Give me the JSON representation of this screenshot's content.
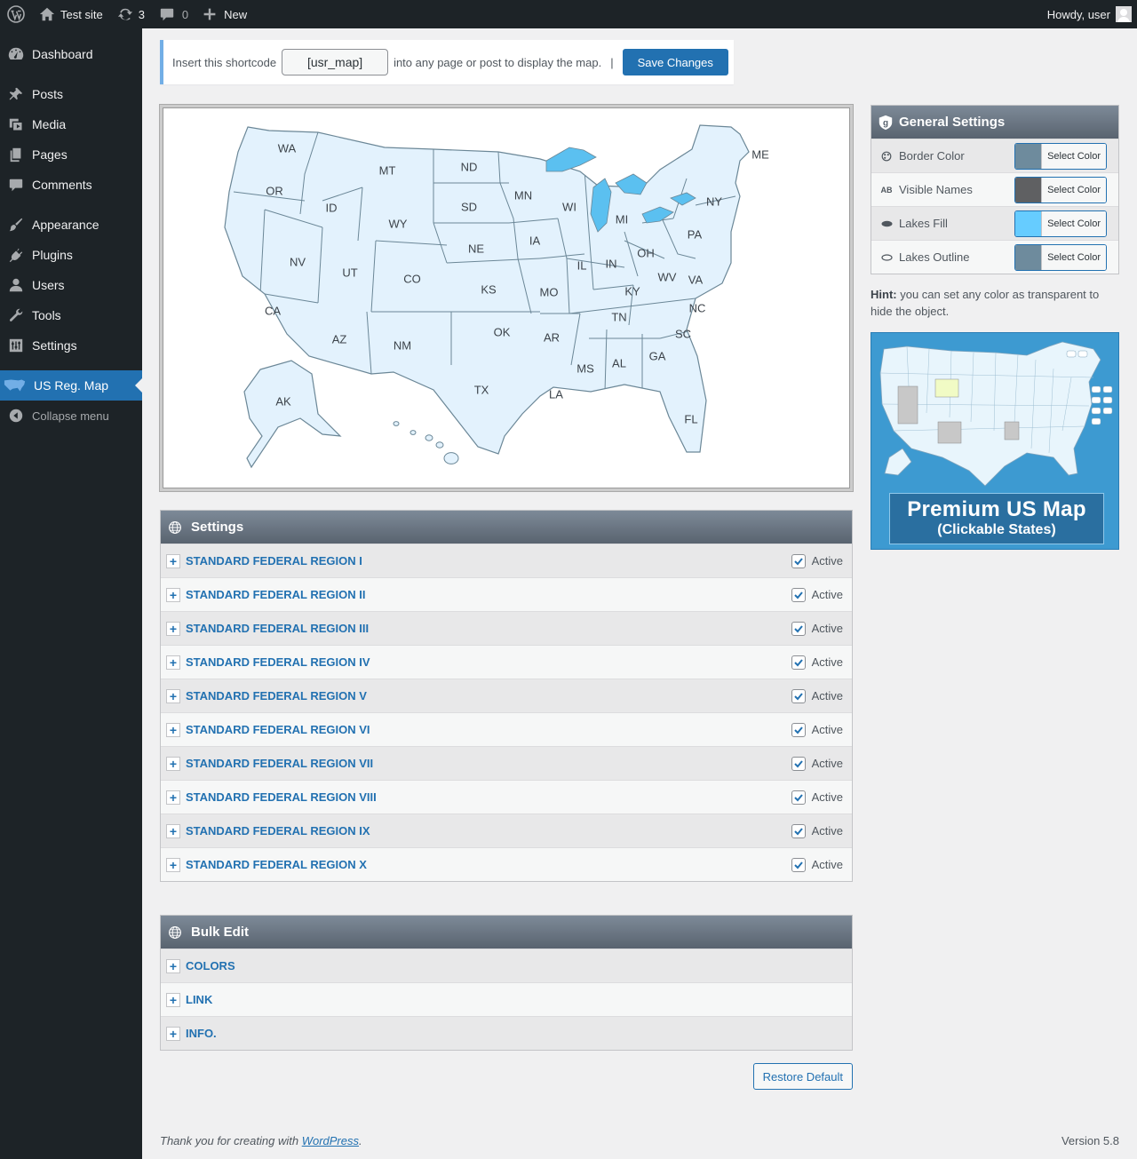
{
  "adminbar": {
    "site_name": "Test site",
    "updates_count": "3",
    "comments_count": "0",
    "new_label": "New",
    "howdy": "Howdy, user"
  },
  "sidebar": {
    "items": [
      {
        "label": "Dashboard"
      },
      {
        "label": "Posts"
      },
      {
        "label": "Media"
      },
      {
        "label": "Pages"
      },
      {
        "label": "Comments"
      },
      {
        "label": "Appearance"
      },
      {
        "label": "Plugins"
      },
      {
        "label": "Users"
      },
      {
        "label": "Tools"
      },
      {
        "label": "Settings"
      },
      {
        "label": "US Reg. Map"
      },
      {
        "label": "Collapse menu"
      }
    ]
  },
  "shortcode": {
    "prefix": "Insert this shortcode",
    "value": "[usr_map]",
    "suffix": "into any page or post to display the map.",
    "separator": "|",
    "save_label": "Save Changes"
  },
  "map": {
    "states": [
      "WA",
      "OR",
      "CA",
      "ID",
      "NV",
      "MT",
      "WY",
      "UT",
      "AZ",
      "CO",
      "NM",
      "ND",
      "SD",
      "NE",
      "KS",
      "OK",
      "TX",
      "MN",
      "IA",
      "MO",
      "AR",
      "LA",
      "WI",
      "IL",
      "MI",
      "IN",
      "OH",
      "KY",
      "TN",
      "MS",
      "AL",
      "GA",
      "FL",
      "SC",
      "NC",
      "VA",
      "WV",
      "PA",
      "NY",
      "ME",
      "AK"
    ],
    "fill": "#e3f2fd",
    "stroke": "#6b8797",
    "lakes_fill": "#5bc0f0"
  },
  "settings_panel": {
    "title": "Settings",
    "active_label": "Active",
    "regions": [
      {
        "label": "STANDARD FEDERAL REGION I"
      },
      {
        "label": "STANDARD FEDERAL REGION II"
      },
      {
        "label": "STANDARD FEDERAL REGION III"
      },
      {
        "label": "STANDARD FEDERAL REGION IV"
      },
      {
        "label": "STANDARD FEDERAL REGION V"
      },
      {
        "label": "STANDARD FEDERAL REGION VI"
      },
      {
        "label": "STANDARD FEDERAL REGION VII"
      },
      {
        "label": "STANDARD FEDERAL REGION VIII"
      },
      {
        "label": "STANDARD FEDERAL REGION IX"
      },
      {
        "label": "STANDARD FEDERAL REGION X"
      }
    ]
  },
  "bulk_edit": {
    "title": "Bulk Edit",
    "items": [
      {
        "label": "COLORS"
      },
      {
        "label": "LINK"
      },
      {
        "label": "INFO."
      }
    ]
  },
  "restore_label": "Restore Default",
  "general_settings": {
    "title": "General Settings",
    "select_label": "Select Color",
    "rows": [
      {
        "label": "Border Color",
        "color": "#6e8b9d"
      },
      {
        "label": "Visible Names",
        "color": "#5f6062",
        "icon_text": "AB"
      },
      {
        "label": "Lakes Fill",
        "color": "#66ccff"
      },
      {
        "label": "Lakes Outline",
        "color": "#6e8b9d"
      }
    ]
  },
  "hint": {
    "bold": "Hint:",
    "text": " you can set any color as transparent to hide the object."
  },
  "promo": {
    "line1": "Premium US Map",
    "line2": "(Clickable States)"
  },
  "footer": {
    "thanks_prefix": "Thank you for creating with ",
    "thanks_link": "WordPress",
    "thanks_suffix": ".",
    "version": "Version 5.8"
  }
}
